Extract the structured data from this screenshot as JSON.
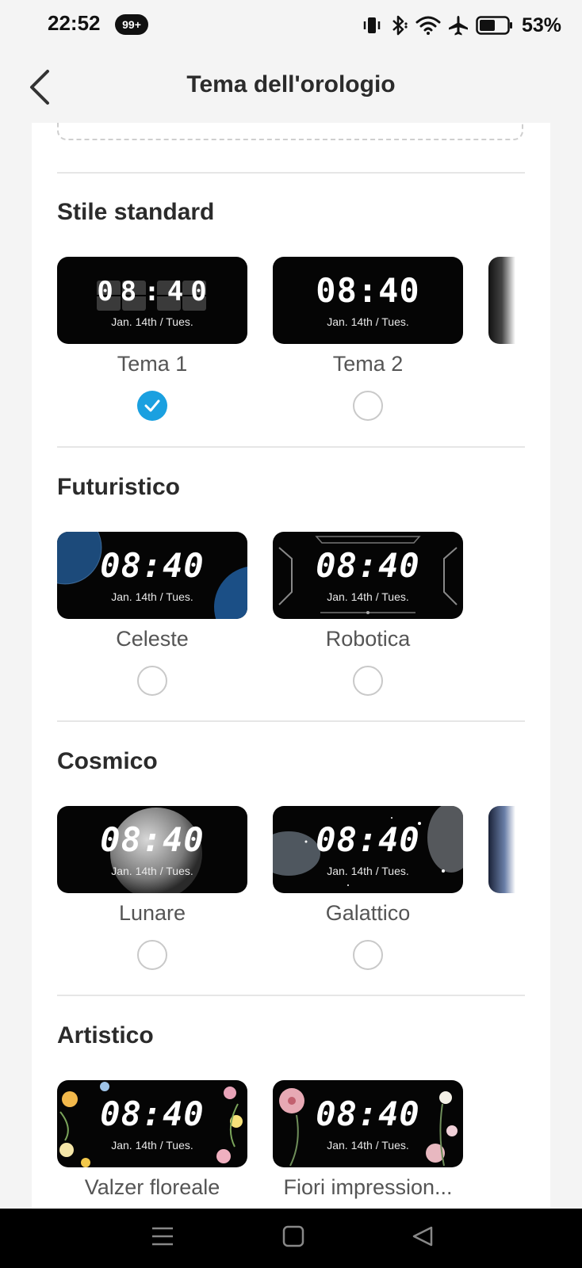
{
  "status_bar": {
    "time": "22:52",
    "notification_badge": "99+",
    "battery_percent": "53%",
    "icons": [
      "vibrate-icon",
      "bluetooth-icon",
      "wifi-icon",
      "airplane-icon",
      "battery-icon"
    ]
  },
  "header": {
    "title": "Tema dell'orologio",
    "back_icon": "chevron-left-icon"
  },
  "accent_color": "#1aa0e0",
  "sections": [
    {
      "title": "Stile standard",
      "themes": [
        {
          "name": "Tema 1",
          "time": "08:40",
          "date": "Jan. 14th / Tues.",
          "selected": true
        },
        {
          "name": "Tema 2",
          "time": "08:40",
          "date": "Jan. 14th / Tues.",
          "selected": false
        }
      ]
    },
    {
      "title": "Futuristico",
      "themes": [
        {
          "name": "Celeste",
          "time": "08:40",
          "date": "Jan. 14th / Tues.",
          "selected": false
        },
        {
          "name": "Robotica",
          "time": "08:40",
          "date": "Jan. 14th / Tues.",
          "selected": false
        }
      ]
    },
    {
      "title": "Cosmico",
      "themes": [
        {
          "name": "Lunare",
          "time": "08:40",
          "date": "Jan. 14th / Tues.",
          "selected": false
        },
        {
          "name": "Galattico",
          "time": "08:40",
          "date": "Jan. 14th / Tues.",
          "selected": false
        }
      ]
    },
    {
      "title": "Artistico",
      "themes": [
        {
          "name": "Valzer floreale",
          "time": "08:40",
          "date": "Jan. 14th / Tues.",
          "selected": false
        },
        {
          "name": "Fiori impression...",
          "time": "08:40",
          "date": "Jan. 14th / Tues.",
          "selected": false
        }
      ]
    }
  ],
  "nav_bar": {
    "icons": [
      "menu-icon",
      "home-icon",
      "back-triangle-icon"
    ]
  }
}
